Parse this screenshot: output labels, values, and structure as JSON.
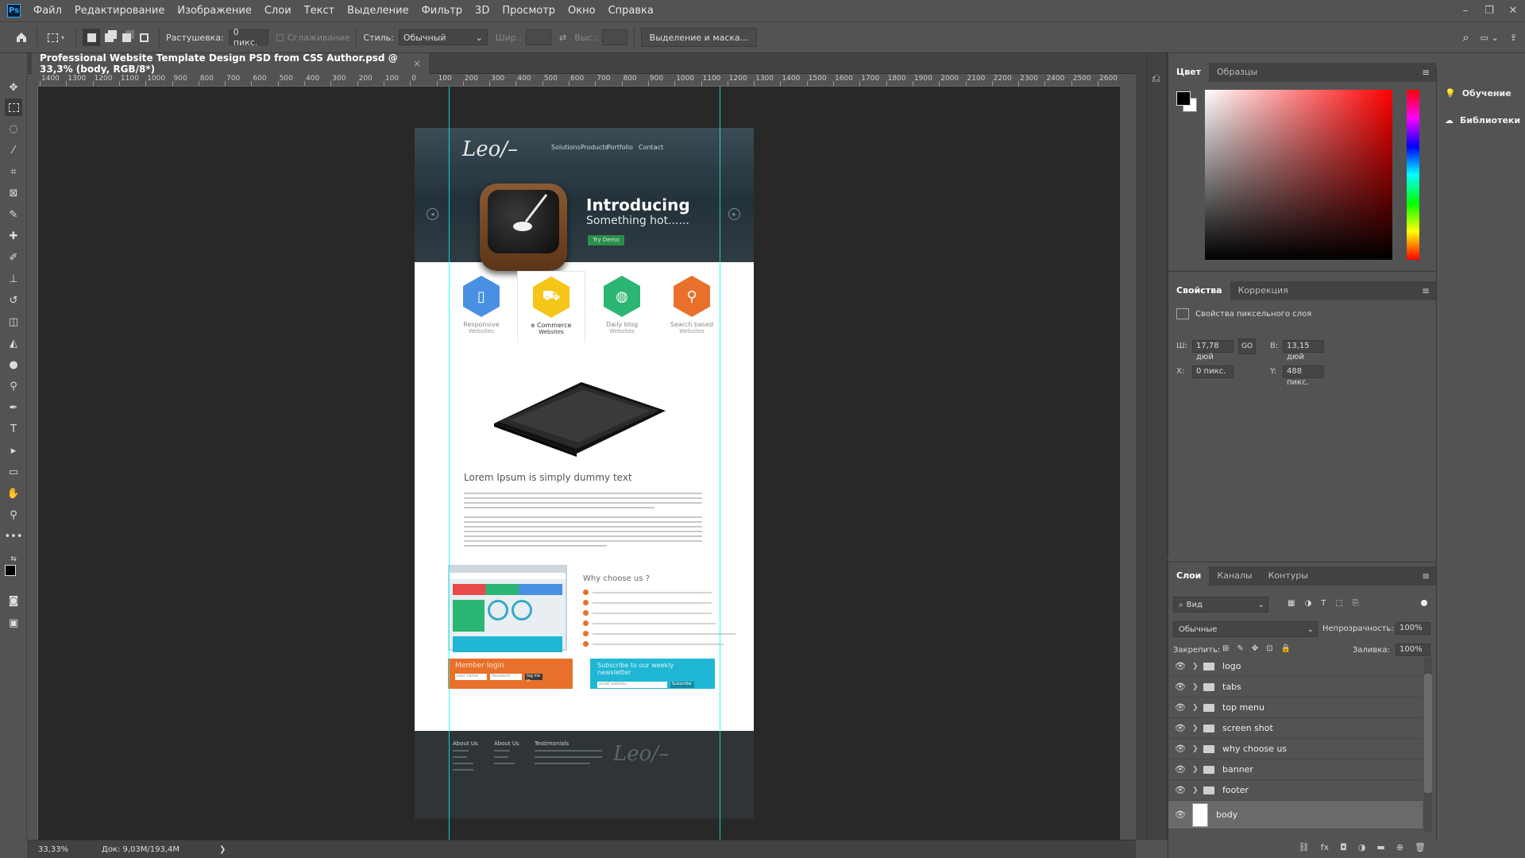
{
  "app": {
    "logo": "Ps"
  },
  "menubar": {
    "items": [
      "Файл",
      "Редактирование",
      "Изображение",
      "Слои",
      "Текст",
      "Выделение",
      "Фильтр",
      "3D",
      "Просмотр",
      "Окно",
      "Справка"
    ]
  },
  "options": {
    "feather_label": "Растушевка:",
    "feather_value": "0 пикс.",
    "antialias_label": "Сглаживание",
    "style_label": "Стиль:",
    "style_value": "Обычный",
    "width_label": "Шир.:",
    "height_label": "Выс.:",
    "select_mask_button": "Выделение и маска..."
  },
  "document": {
    "tab_title": "Professional Website Template Design  PSD from CSS Author.psd @ 33,3% (body, RGB/8*)",
    "close": "×"
  },
  "ruler": {
    "labels": [
      "1400",
      "1300",
      "1200",
      "1100",
      "1000",
      "900",
      "800",
      "700",
      "600",
      "500",
      "400",
      "300",
      "200",
      "100",
      "0",
      "100",
      "200",
      "300",
      "400",
      "500",
      "600",
      "700",
      "800",
      "900",
      "1000",
      "1100",
      "1200",
      "1300",
      "1400",
      "1500",
      "1600",
      "1700",
      "1800",
      "1900",
      "2000",
      "2100",
      "2200",
      "2300",
      "2400",
      "2500",
      "2600"
    ]
  },
  "site": {
    "logo": "Leo/–",
    "nav": [
      "Solutions",
      "Products",
      "Portfolio",
      "Contact"
    ],
    "hero_title": "Introducing",
    "hero_sub": "Something hot......",
    "hero_button": "Try Demo",
    "services": [
      {
        "title": "Responsive",
        "sub": "Websites",
        "color": "#4a90e2"
      },
      {
        "title": "e Commerce",
        "sub": "Websites",
        "color": "#f5c518"
      },
      {
        "title": "Daily blog",
        "sub": "Websites",
        "color": "#2bb673"
      },
      {
        "title": "Search based",
        "sub": "Websites",
        "color": "#e8702a"
      }
    ],
    "lorem_heading": "Lorem Ipsum is simply dummy text",
    "why_heading": "Why choose us ?",
    "login_title": "Member login",
    "login_user": "user name",
    "login_pass": "Password",
    "login_btn": "log me in",
    "news_title": "Subscribe to our weekly newsletter",
    "news_field": "email address",
    "news_btn": "Subscribe",
    "footer_cols": [
      "About Us",
      "About Us",
      "Testimonials"
    ],
    "footer_logo": "Leo/–"
  },
  "panels": {
    "color_tabs": [
      "Цвет",
      "Образцы"
    ],
    "props_tabs": [
      "Свойства",
      "Коррекция"
    ],
    "props_title": "Свойства пиксельного слоя",
    "w_label": "Ш:",
    "w_value": "17,78 дюй",
    "h_label": "В:",
    "h_value": "13,15 дюй",
    "link_icon": "GO",
    "x_label": "X:",
    "x_value": "0 пикс.",
    "y_label": "Y:",
    "y_value": "488 пикс.",
    "layers_tabs": [
      "Слои",
      "Каналы",
      "Контуры"
    ],
    "filter_value": "Вид",
    "blend_value": "Обычные",
    "opacity_label": "Непрозрачность:",
    "opacity_value": "100%",
    "lock_label": "Закрепить:",
    "fill_label": "Заливка:",
    "fill_value": "100%",
    "learn": "Обучение",
    "libraries": "Библиотеки"
  },
  "layers": [
    "logo",
    "tabs",
    "top menu",
    "screen shot",
    "why choose us",
    "banner",
    "footer",
    "body"
  ],
  "status": {
    "zoom": "33,33%",
    "doc": "Док: 9,03M/193,4M",
    "arrow": "❯"
  }
}
